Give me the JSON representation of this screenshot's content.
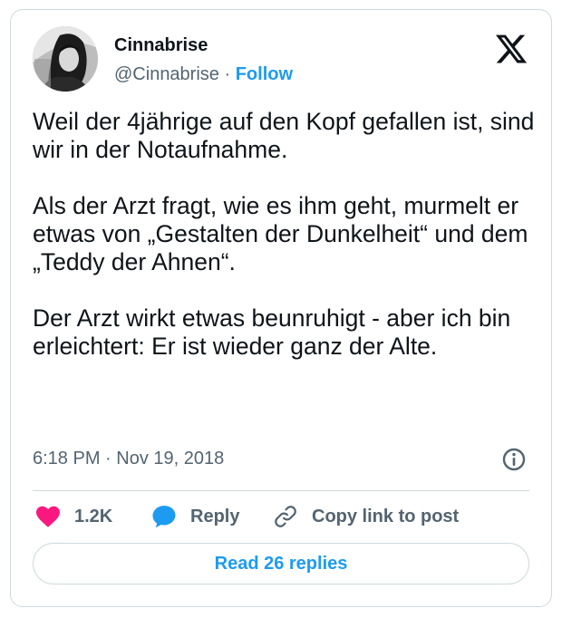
{
  "tweet": {
    "author_name": "Cinnabrise",
    "handle": "@Cinnabrise",
    "separator": "·",
    "follow_label": "Follow",
    "text": "Weil der 4jährige auf den Kopf gefallen ist, sind wir in der Notaufnahme.\n\nAls der Arzt fragt, wie es ihm geht, murmelt er etwas von „Gestalten der Dunkelheit“ und dem „Teddy der Ahnen“.\n\nDer Arzt wirkt etwas beunruhigt - aber ich bin erleichtert: Er ist wieder ganz der Alte.",
    "timestamp": "6:18 PM · Nov 19, 2018"
  },
  "actions": {
    "like_count": "1.2K",
    "reply_label": "Reply",
    "copy_link_label": "Copy link to post"
  },
  "read_replies_label": "Read 26 replies",
  "icons": {
    "platform": "x-logo-icon",
    "info": "info-icon",
    "like": "heart-icon",
    "reply": "speech-bubble-icon",
    "copy": "link-icon"
  },
  "colors": {
    "like": "#f91880",
    "reply": "#1d9bf0",
    "follow": "#1d9bf0",
    "muted": "#536471",
    "border": "#cfd9de"
  }
}
